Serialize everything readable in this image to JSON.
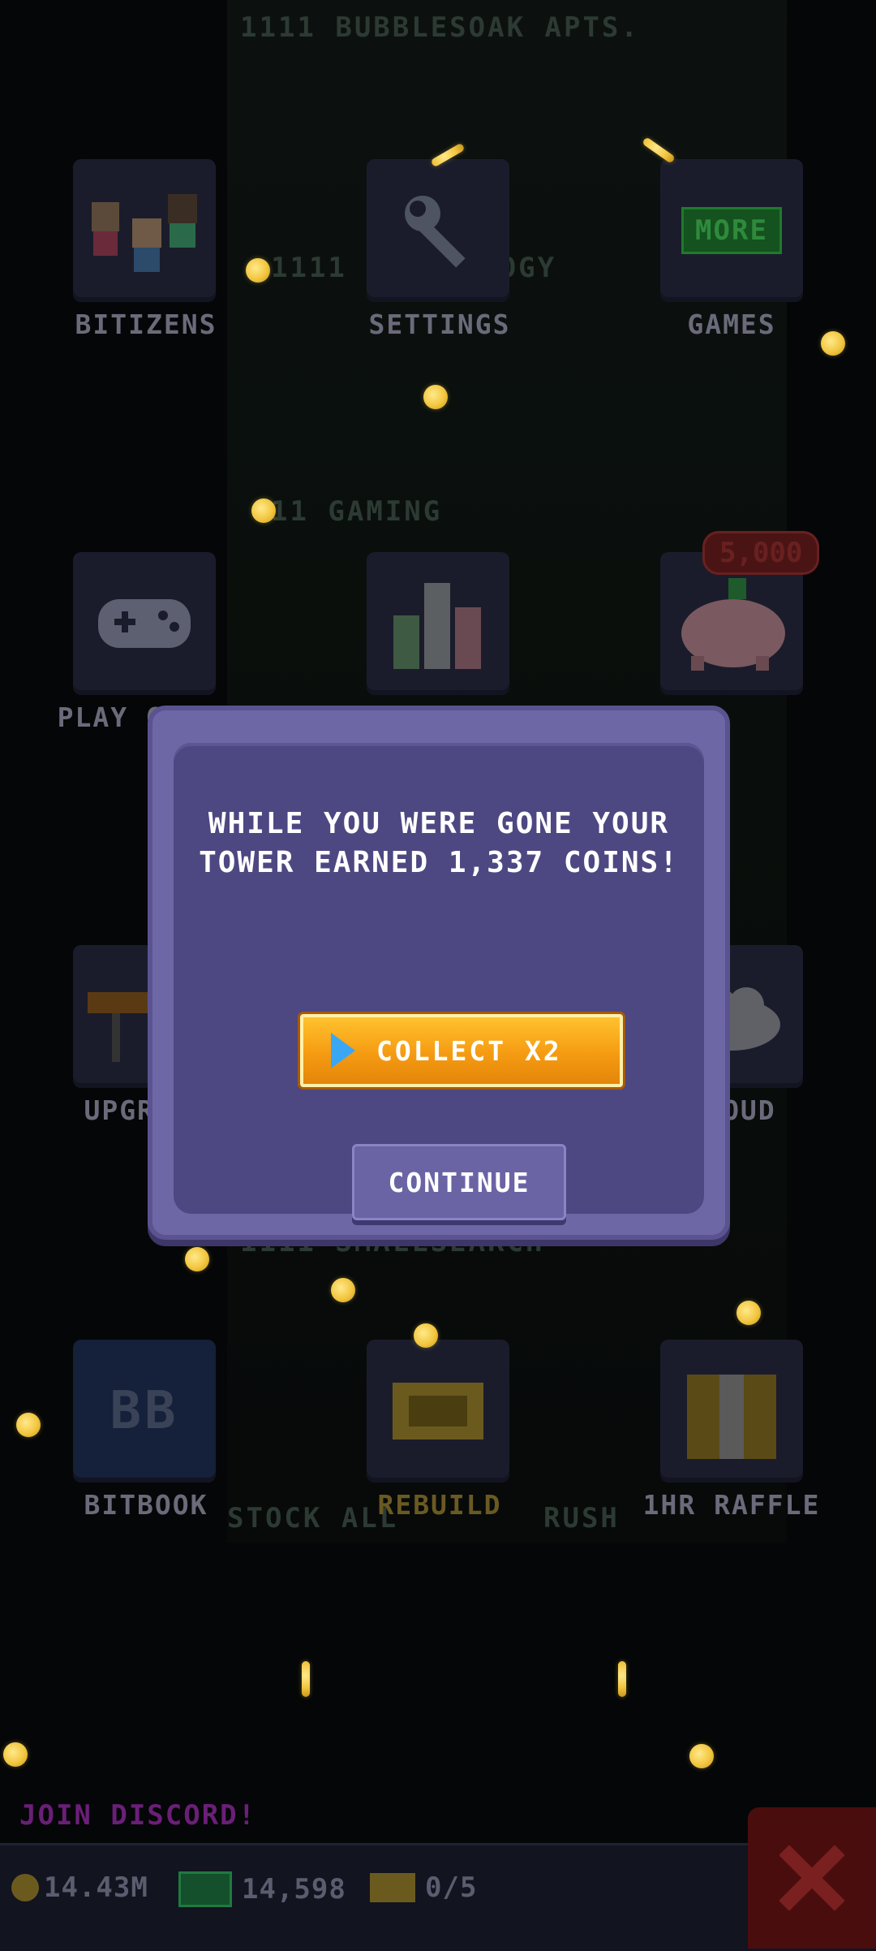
{
  "background_labels": {
    "apts": "1111 BUBBLESOAK APTS.",
    "tech": "1111 TECHNOLOGY",
    "gaming": "11 GAMING",
    "shop": "1111 SMALLSEARCH",
    "stock": "STOCK ALL",
    "rush": "RUSH"
  },
  "menu": {
    "bitizens": "BITIZENS",
    "settings": "SETTINGS",
    "games": "GAMES",
    "games_badge": "MORE",
    "play_games": "PLAY GAMES",
    "piggy_badge": "5,000",
    "upgrade": "UPGRADE",
    "cloud": "CLOUD",
    "bitbook": "BITBOOK",
    "bitbook_icon_text": "BB",
    "rebuild": "REBUILD",
    "raffle": "1HR RAFFLE"
  },
  "modal": {
    "message_line1": "WHILE YOU WERE GONE YOUR",
    "message_line2": "TOWER EARNED 1,337 COINS!",
    "collect_label": "COLLECT X2",
    "continue_label": "CONTINUE"
  },
  "footer": {
    "join_discord": "JOIN DISCORD!",
    "coins": "14.43M",
    "bux": "14,598",
    "tickets": "0/5"
  },
  "colors": {
    "modal_outer": "#6e67a6",
    "modal_inner": "#4d4882",
    "collect_orange": "#f59b12",
    "coin_gold": "#f2c640"
  }
}
